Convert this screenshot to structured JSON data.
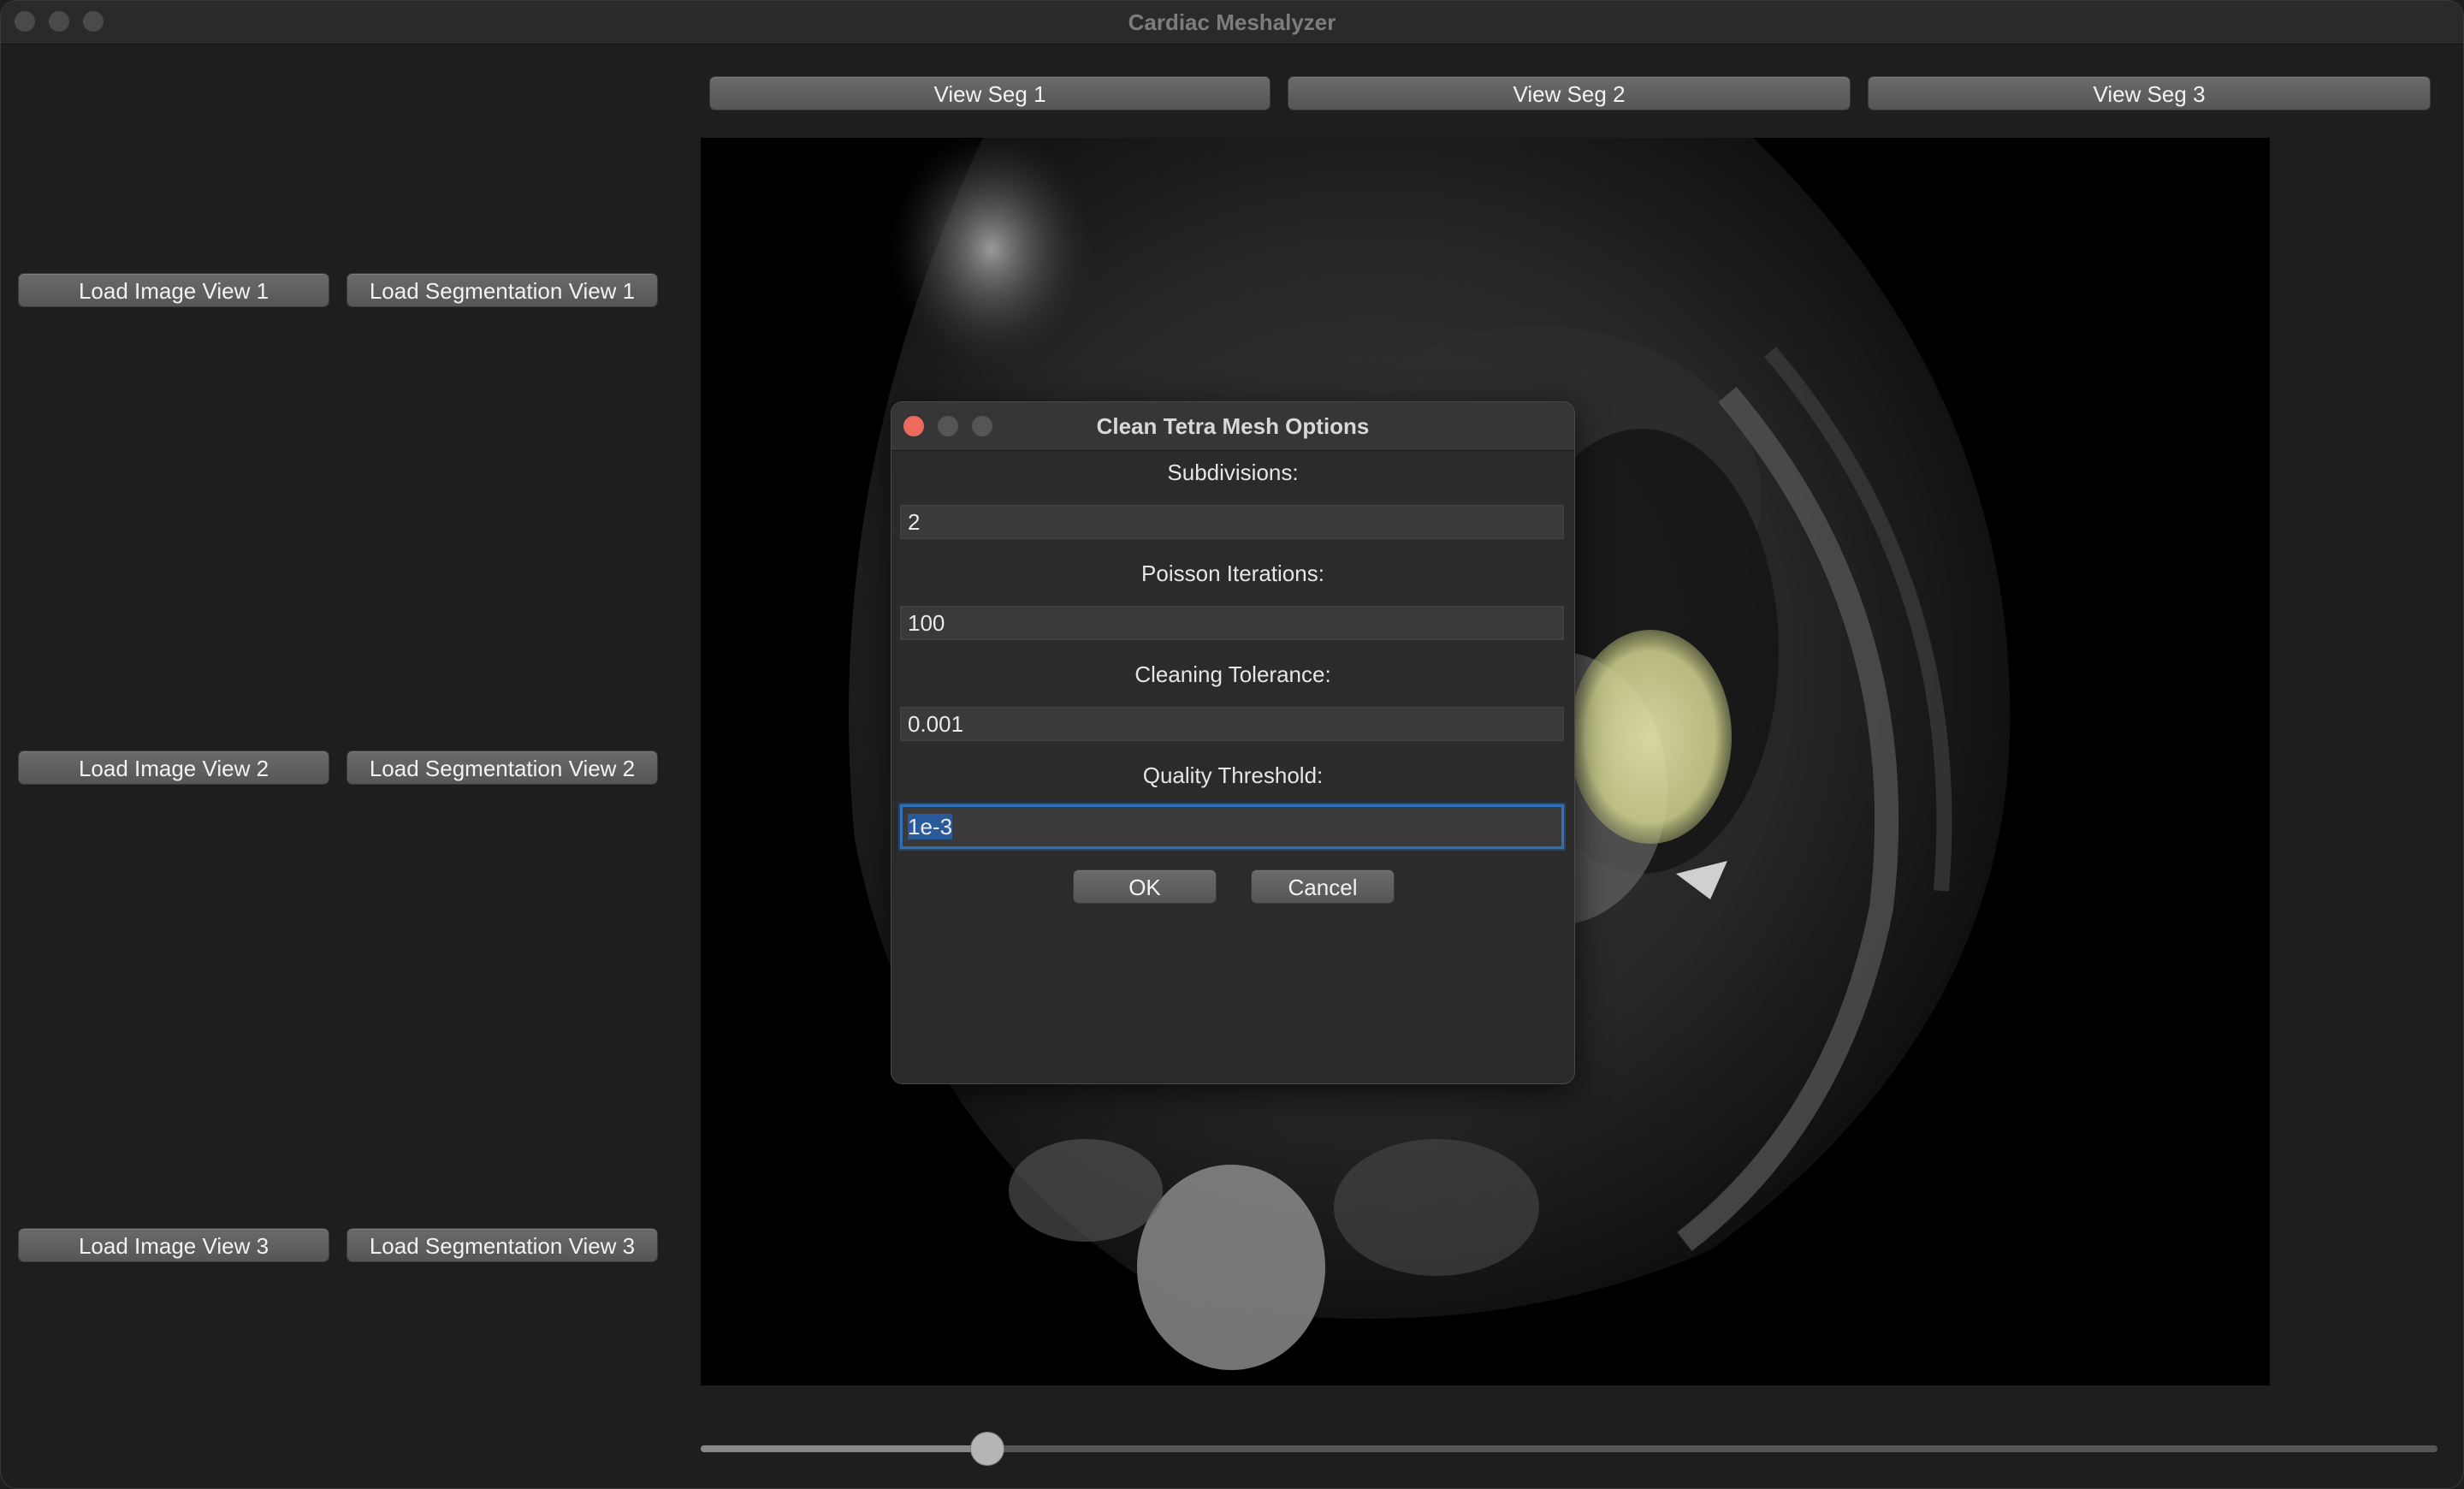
{
  "window": {
    "title": "Cardiac Meshalyzer"
  },
  "view_seg_buttons": [
    "View Seg 1",
    "View Seg 2",
    "View Seg 3"
  ],
  "load_buttons": [
    {
      "image": "Load Image View 1",
      "segmentation": "Load Segmentation View 1"
    },
    {
      "image": "Load Image View 2",
      "segmentation": "Load Segmentation View 2"
    },
    {
      "image": "Load Image View 3",
      "segmentation": "Load Segmentation View 3"
    }
  ],
  "slice_slider": {
    "value_fraction": 0.165
  },
  "dialog": {
    "title": "Clean Tetra Mesh Options",
    "fields": [
      {
        "label": "Subdivisions:",
        "value": "2"
      },
      {
        "label": "Poisson Iterations:",
        "value": "100"
      },
      {
        "label": "Cleaning Tolerance:",
        "value": "0.001"
      },
      {
        "label": "Quality Threshold:",
        "value": "1e-3"
      }
    ],
    "ok_label": "OK",
    "cancel_label": "Cancel"
  },
  "colors": {
    "close_red": "#ed6a5e",
    "focus_blue": "#2f6fb6",
    "segmentation_overlay": "#e3e6a8"
  }
}
